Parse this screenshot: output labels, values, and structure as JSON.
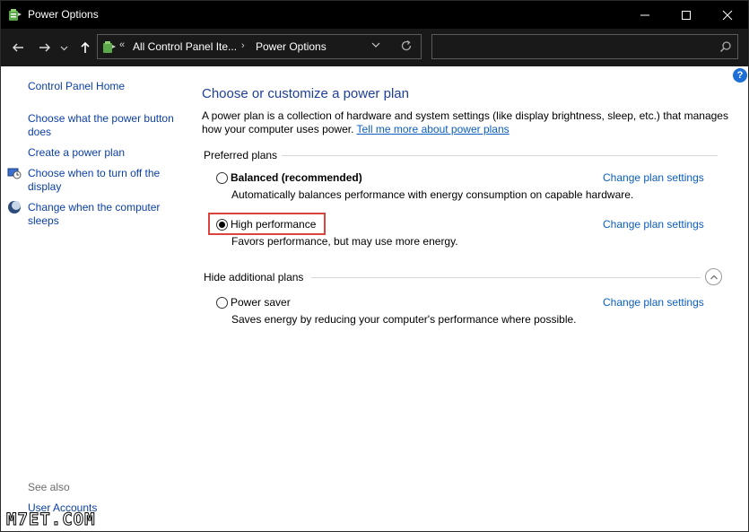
{
  "window": {
    "title": "Power Options"
  },
  "address": {
    "overflow_marker": "«",
    "crumbs": [
      "All Control Panel Ite...",
      "Power Options"
    ],
    "separator": "›",
    "search_placeholder": ""
  },
  "left_pane": {
    "home": "Control Panel Home",
    "links": [
      "Choose what the power button does",
      "Create a power plan",
      "Choose when to turn off the display",
      "Change when the computer sleeps"
    ],
    "see_also_label": "See also",
    "see_also_links": [
      "User Accounts"
    ]
  },
  "main": {
    "title": "Choose or customize a power plan",
    "description": "A power plan is a collection of hardware and system settings (like display brightness, sleep, etc.) that manages how your computer uses power.",
    "learn_more": "Tell me more about power plans",
    "preferred_header": "Preferred plans",
    "additional_header": "Hide additional plans",
    "change_label": "Change plan settings",
    "plans": [
      {
        "name": "Balanced (recommended)",
        "description": "Automatically balances performance with energy consumption on capable hardware.",
        "selected": false
      },
      {
        "name": "High performance",
        "description": "Favors performance, but may use more energy.",
        "selected": true
      },
      {
        "name": "Power saver",
        "description": "Saves energy by reducing your computer's performance where possible.",
        "selected": false
      }
    ]
  },
  "watermark": "M7ET.COM",
  "colors": {
    "link": "#0b5ebf",
    "title": "#1e3f9a",
    "highlight": "#d9453c",
    "titlebar": "#000000"
  },
  "icons": {
    "app": "power-options-icon",
    "help": "help-icon",
    "back": "back-arrow-icon",
    "forward": "forward-arrow-icon",
    "up": "up-arrow-icon",
    "search": "search-icon"
  }
}
